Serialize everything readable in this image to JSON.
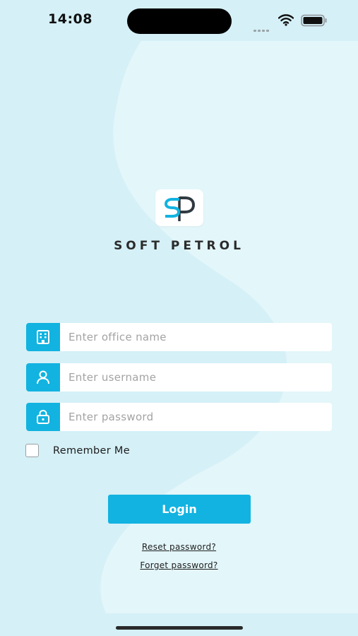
{
  "status_bar": {
    "time": "14:08",
    "icons": [
      "signal-dots-icon",
      "wifi-icon",
      "battery-icon"
    ]
  },
  "brand": {
    "logo_icon": "soft-petrol-logo",
    "name": "SOFT PETROL",
    "colors": {
      "accent": "#12b3e0",
      "background": "#d7f1f8"
    }
  },
  "form": {
    "office": {
      "placeholder": "Enter office name",
      "value": "",
      "icon": "building-icon"
    },
    "username": {
      "placeholder": "Enter username",
      "value": "",
      "icon": "user-icon"
    },
    "password": {
      "placeholder": "Enter password",
      "value": "",
      "icon": "lock-icon"
    },
    "remember_me": {
      "label": "Remember Me",
      "checked": false
    },
    "login_label": "Login"
  },
  "links": {
    "reset_password": "Reset password?",
    "forget_password": "Forget password?"
  }
}
